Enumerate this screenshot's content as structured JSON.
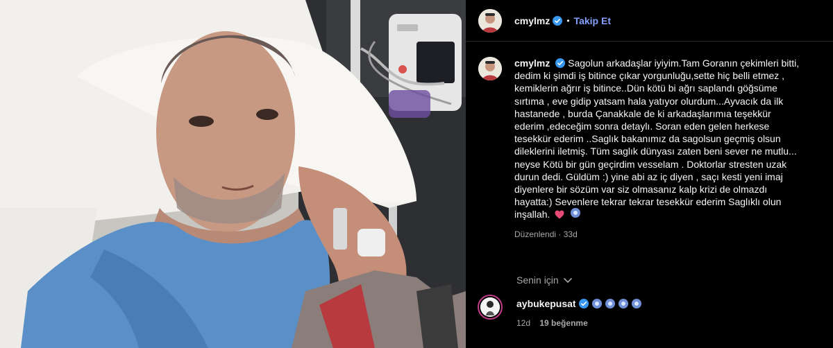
{
  "post": {
    "username": "cmylmz",
    "separator": "•",
    "follow_label": "Takip Et",
    "caption_lines": [
      "Sagolun arkadaşlar iyiyim.Tam Goranın çekimleri bitti,",
      "dedim ki şimdi iş bitince çıkar yorgunluğu,sette hiç belli etmez ,",
      "kemiklerin ağrır iş bitince..Dün kötü bi ağrı saplandı göğsüme",
      "sırtıma , eve gidip yatsam hala yatıyor olurdum...Ayvacık da ilk",
      "hastanede , burda Çanakkale de ki arkadaşlarımıa teşekkür",
      "ederim ,edeceğim sonra detaylı. Soran eden gelen herkese",
      "tesekkür ederim ..Saglık bakanımız da sagolsun geçmiş olsun",
      "dileklerini iletmiş. Tüm saglık dünyası zaten beni sever ne mutlu...",
      "neyse Kötü bir gün geçirdim vesselam . Doktorlar stresten uzak",
      "durun dedi. Güldüm :) yine abi az iç diyen , saçı kesti yeni imaj",
      "diyenlere bir sözüm var siz olmasanız kalp krizi de olmazdı",
      "hayatta:) Sevenlere tekrar tekrar tesekkür ederim Saglıklı olun",
      "inşallah."
    ],
    "edited_label": "Düzenlendi",
    "edited_sep": "·",
    "edited_time": "33d"
  },
  "comments_section": {
    "for_you_label": "Senin için"
  },
  "comment": {
    "username": "aybukepusat",
    "time": "12d",
    "likes": "19 beğenme"
  },
  "icons": {
    "verified": "verified-badge-icon",
    "more": "more-options-icon",
    "chevron": "chevron-down-icon",
    "heart": "heart-emoji-icon",
    "blue_eye": "evil-eye-emoji-icon"
  },
  "colors": {
    "accent_link": "#85a1ff",
    "verified": "#3897f0",
    "heart": "#e64a75",
    "muted": "#a8a8a8"
  }
}
